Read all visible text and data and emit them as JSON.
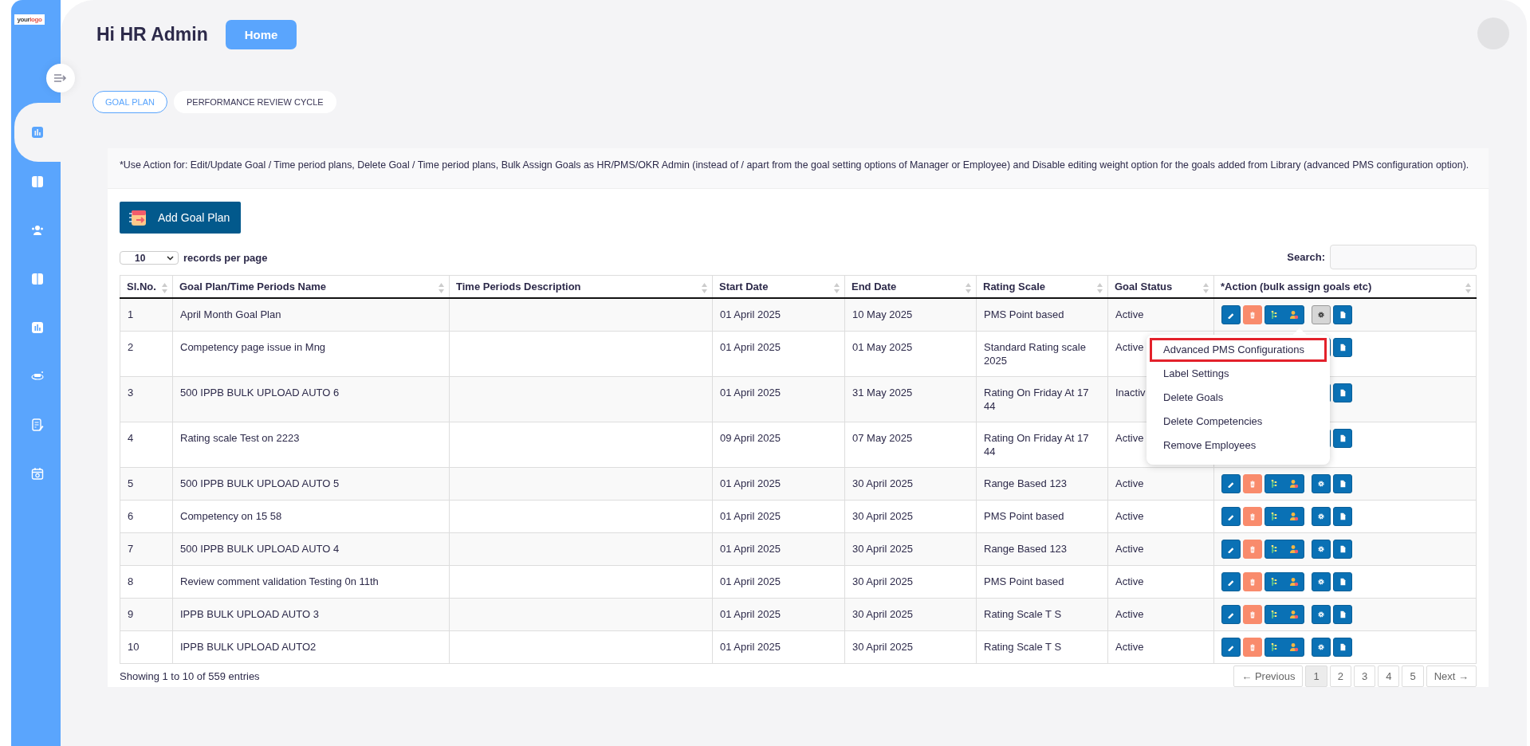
{
  "sidebar": {
    "logo": {
      "text_1": "your",
      "text_2": "logo"
    },
    "items": [
      {
        "selected": true
      },
      {
        "selected": false
      },
      {
        "selected": false
      },
      {
        "selected": false
      },
      {
        "selected": false
      },
      {
        "selected": false
      },
      {
        "selected": false
      },
      {
        "selected": false
      }
    ]
  },
  "header": {
    "greeting": "Hi HR Admin",
    "home_button": "Home"
  },
  "tabs": [
    {
      "label": "GOAL PLAN",
      "selected": true
    },
    {
      "label": "PERFORMANCE REVIEW CYCLE",
      "selected": false
    }
  ],
  "note": "*Use Action for: Edit/Update Goal / Time period plans, Delete Goal / Time period plans, Bulk Assign Goals as HR/PMS/OKR Admin (instead of / apart from the goal setting options of Manager or Employee) and Disable editing weight option for the goals added from Library (advanced PMS configuration option).",
  "add_button": "Add Goal Plan",
  "page_size": {
    "value": "10",
    "label": "records per page"
  },
  "search": {
    "label": "Search:"
  },
  "table": {
    "columns": [
      "Sl.No.",
      "Goal Plan/Time Periods Name",
      "Time Periods Description",
      "Start Date",
      "End Date",
      "Rating Scale",
      "Goal Status",
      "*Action (bulk assign goals etc)"
    ],
    "rows": [
      {
        "cells": [
          "1",
          "April Month Goal Plan",
          "",
          "01 April 2025",
          "10 May 2025",
          "PMS Point based",
          "Active"
        ],
        "menu_open": true
      },
      {
        "cells": [
          "2",
          "Competency page issue in Mng",
          "",
          "01 April 2025",
          "01 May 2025",
          "Standard Rating scale 2025",
          "Active"
        ],
        "menu_open": false
      },
      {
        "cells": [
          "3",
          "500 IPPB BULK UPLOAD AUTO 6",
          "",
          "01 April 2025",
          "31 May 2025",
          "Rating On Friday At 17 44",
          "Inactiv"
        ],
        "menu_open": false
      },
      {
        "cells": [
          "4",
          "Rating scale Test on 2223",
          "",
          "09 April 2025",
          "07 May 2025",
          "Rating On Friday At 17 44",
          "Active"
        ],
        "menu_open": false
      },
      {
        "cells": [
          "5",
          "500 IPPB BULK UPLOAD AUTO 5",
          "",
          "01 April 2025",
          "30 April 2025",
          "Range Based 123",
          "Active"
        ],
        "menu_open": false
      },
      {
        "cells": [
          "6",
          "Competency on 15 58",
          "",
          "01 April 2025",
          "30 April 2025",
          "PMS Point based",
          "Active"
        ],
        "menu_open": false
      },
      {
        "cells": [
          "7",
          "500 IPPB BULK UPLOAD AUTO 4",
          "",
          "01 April 2025",
          "30 April 2025",
          "Range Based 123",
          "Active"
        ],
        "menu_open": false
      },
      {
        "cells": [
          "8",
          "Review comment validation Testing 0n 11th",
          "",
          "01 April 2025",
          "30 April 2025",
          "PMS Point based",
          "Active"
        ],
        "menu_open": false
      },
      {
        "cells": [
          "9",
          "IPPB BULK UPLOAD AUTO 3",
          "",
          "01 April 2025",
          "30 April 2025",
          "Rating Scale T S",
          "Active"
        ],
        "menu_open": false
      },
      {
        "cells": [
          "10",
          "IPPB BULK UPLOAD AUTO2",
          "",
          "01 April 2025",
          "30 April 2025",
          "Rating Scale T S",
          "Active"
        ],
        "menu_open": false
      }
    ]
  },
  "action_menu": {
    "items": [
      {
        "label": "Advanced PMS Configurations",
        "highlighted": true
      },
      {
        "label": "Label Settings",
        "highlighted": false
      },
      {
        "label": "Delete Goals",
        "highlighted": false
      },
      {
        "label": "Delete Competencies",
        "highlighted": false
      },
      {
        "label": "Remove Employees",
        "highlighted": false
      }
    ]
  },
  "footer": {
    "info": "Showing 1 to 10 of 559 entries",
    "pagination": [
      {
        "label": "← Previous",
        "selected": false
      },
      {
        "label": "1",
        "selected": true
      },
      {
        "label": "2",
        "selected": false
      },
      {
        "label": "3",
        "selected": false
      },
      {
        "label": "4",
        "selected": false
      },
      {
        "label": "5",
        "selected": false
      },
      {
        "label": "Next →",
        "selected": false
      }
    ]
  }
}
